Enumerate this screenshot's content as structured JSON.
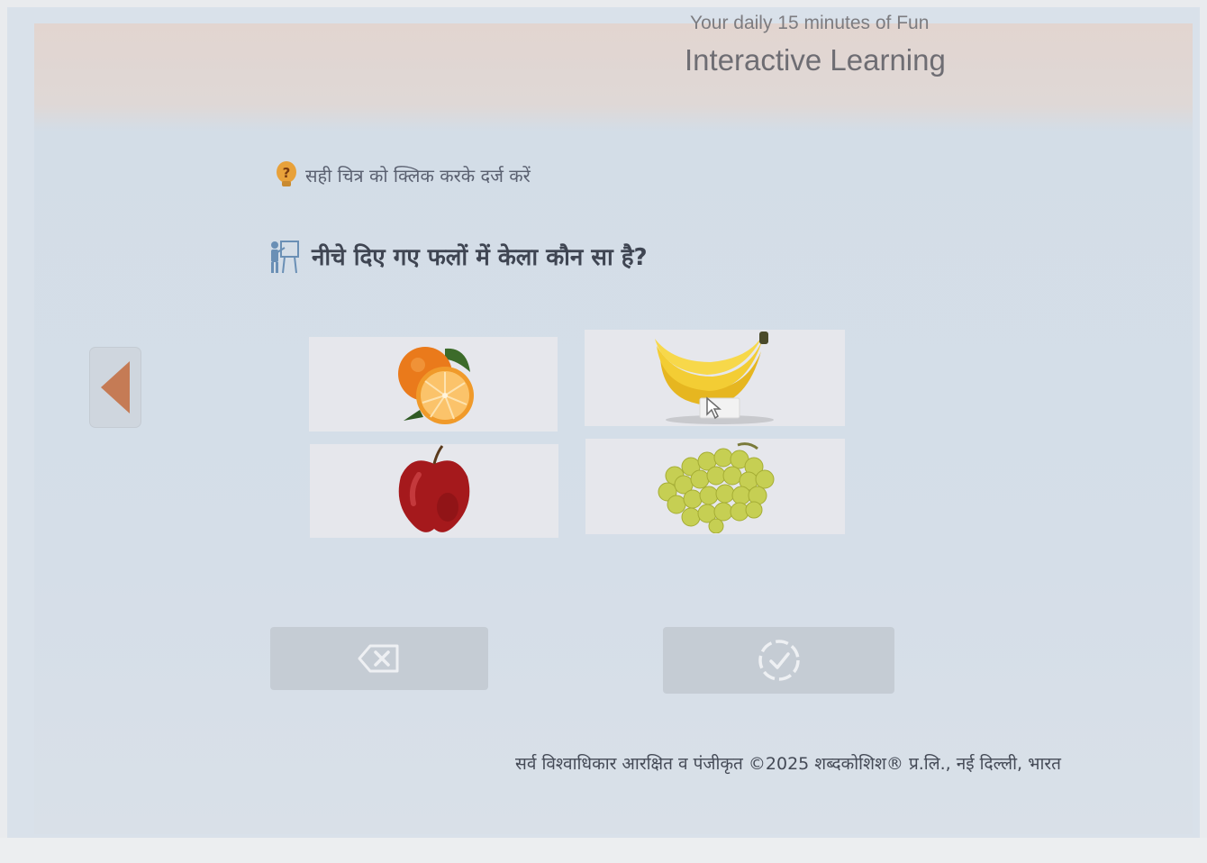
{
  "header": {
    "subtitle": "Your daily 15 minutes of Fun",
    "title": "Interactive Learning"
  },
  "quiz": {
    "instruction": "सही चित्र को क्लिक करके दर्ज करें",
    "question": "नीचे दिए गए फलों में केला कौन सा है?",
    "options": [
      {
        "fruit": "orange"
      },
      {
        "fruit": "banana"
      },
      {
        "fruit": "apple"
      },
      {
        "fruit": "grapes"
      }
    ]
  },
  "controls": {
    "back_icon": "caret-left-icon",
    "clear_icon": "backspace-icon",
    "submit_icon": "check-circle-icon"
  },
  "footer": {
    "copyright": "सर्व विश्वाधिकार आरक्षित व पंजीकृत ©2025 शब्दकोशिश® प्र.लि., नई दिल्ली, भारत"
  },
  "colors": {
    "accent": "#c57b55",
    "button_bg": "#c5ccd4",
    "icon_light": "#eef0f3"
  }
}
